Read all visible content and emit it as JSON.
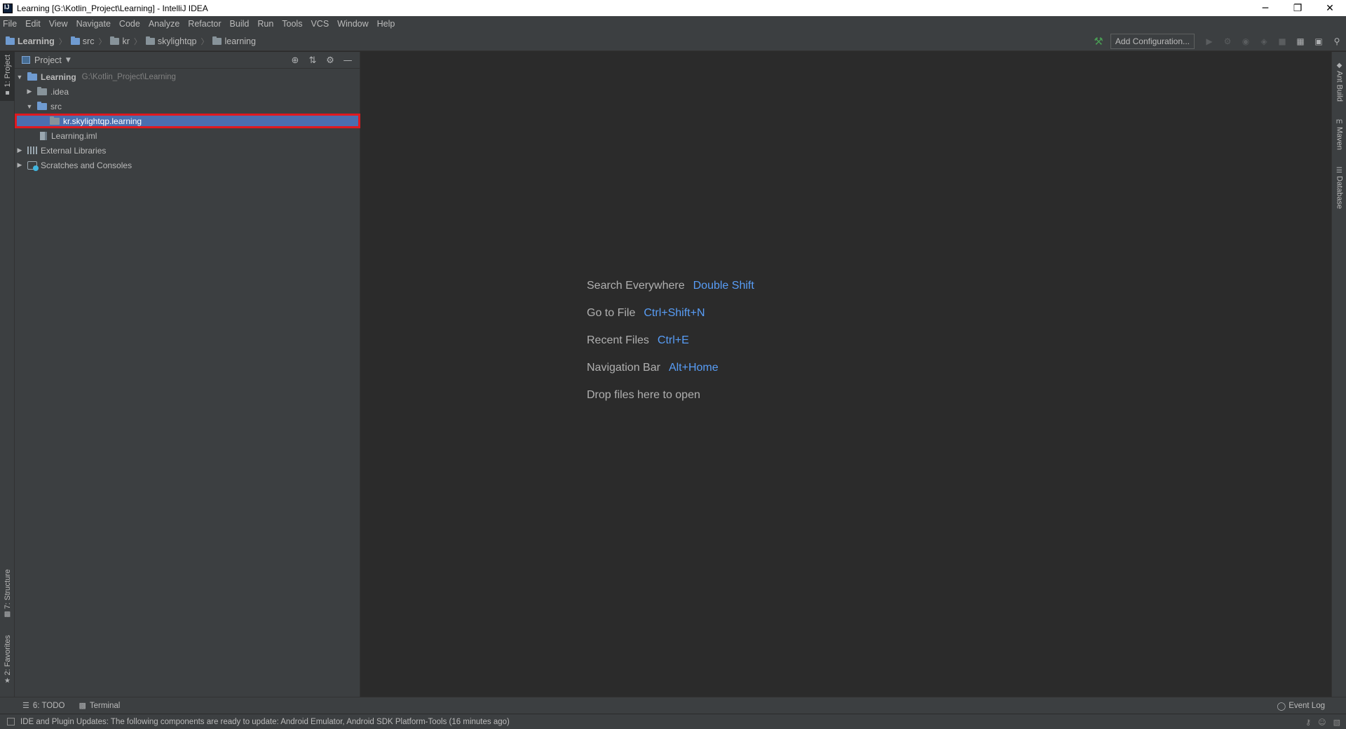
{
  "window": {
    "title": "Learning [G:\\Kotlin_Project\\Learning] - IntelliJ IDEA",
    "minimize": "─",
    "restore": "❐",
    "close": "✕"
  },
  "menu": {
    "file": "File",
    "edit": "Edit",
    "view": "View",
    "navigate": "Navigate",
    "code": "Code",
    "analyze": "Analyze",
    "refactor": "Refactor",
    "build": "Build",
    "run": "Run",
    "tools": "Tools",
    "vcs": "VCS",
    "window": "Window",
    "help": "Help"
  },
  "breadcrumb": [
    "Learning",
    "src",
    "kr",
    "skylightqp",
    "learning"
  ],
  "toolbar": {
    "add_configuration": "Add Configuration..."
  },
  "left_tabs": {
    "project": "1: Project",
    "structure": "7: Structure",
    "favorites": "2: Favorites"
  },
  "right_tabs": {
    "ant": "Ant Build",
    "maven": "Maven",
    "database": "Database"
  },
  "project_panel": {
    "title": "Project",
    "tree": [
      {
        "name": "Learning",
        "path": "G:\\Kotlin_Project\\Learning"
      },
      {
        "name": ".idea"
      },
      {
        "name": "src"
      },
      {
        "name": "kr.skylightqp.learning"
      },
      {
        "name": "Learning.iml"
      },
      {
        "name": "External Libraries"
      },
      {
        "name": "Scratches and Consoles"
      }
    ]
  },
  "editor_hints": [
    {
      "label": "Search Everywhere",
      "key": "Double Shift"
    },
    {
      "label": "Go to File",
      "key": "Ctrl+Shift+N"
    },
    {
      "label": "Recent Files",
      "key": "Ctrl+E"
    },
    {
      "label": "Navigation Bar",
      "key": "Alt+Home"
    },
    {
      "label": "Drop files here to open",
      "key": ""
    }
  ],
  "bottom_tabs": {
    "todo": "6: TODO",
    "terminal": "Terminal",
    "event_log": "Event Log"
  },
  "status": {
    "message": "IDE and Plugin Updates: The following components are ready to update: Android Emulator, Android SDK Platform-Tools (16 minutes ago)"
  },
  "colors": {
    "selection": "#4b6eaf",
    "highlight_border": "#e0191f",
    "hint_key": "#589df6"
  }
}
